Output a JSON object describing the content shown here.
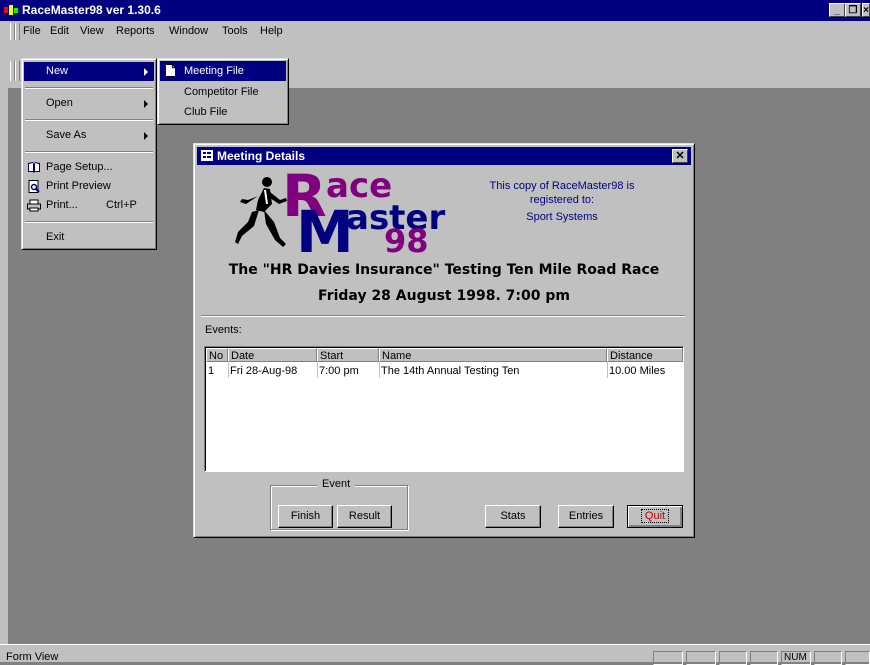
{
  "app": {
    "title": "RaceMaster98 ver 1.30.6"
  },
  "menubar": {
    "items": [
      "File",
      "Edit",
      "View",
      "Reports",
      "Window",
      "Tools",
      "Help"
    ]
  },
  "file_menu": {
    "new": "New",
    "open": "Open",
    "save_as": "Save As",
    "page_setup": "Page Setup...",
    "print_preview": "Print Preview",
    "print": "Print...",
    "print_shortcut": "Ctrl+P",
    "exit": "Exit"
  },
  "new_menu": {
    "items": [
      "Meeting File",
      "Competitor File",
      "Club File"
    ]
  },
  "dialog": {
    "title": "Meeting Details",
    "logo": {
      "line1": "ace",
      "line2": "aster",
      "line3": "98",
      "r": "R",
      "m": "M"
    },
    "registered": [
      "This copy of RaceMaster98 is",
      "registered to:",
      "Sport Systems"
    ],
    "race_title": "The \"HR Davies Insurance\" Testing Ten Mile Road Race",
    "race_date": "Friday 28 August 1998. 7:00 pm",
    "events_label": "Events:",
    "columns": [
      "No",
      "Date",
      "Start",
      "Name",
      "Distance"
    ],
    "rows": [
      {
        "no": "1",
        "date": "Fri 28-Aug-98",
        "start": "7:00 pm",
        "name": "The 14th Annual Testing Ten",
        "distance": "10.00 Miles"
      }
    ],
    "event_group_label": "Event",
    "buttons": {
      "finish": "Finish",
      "result": "Result",
      "stats": "Stats",
      "entries": "Entries",
      "quit": "Quit"
    }
  },
  "statusbar": {
    "text": "Form View",
    "num": "NUM"
  }
}
